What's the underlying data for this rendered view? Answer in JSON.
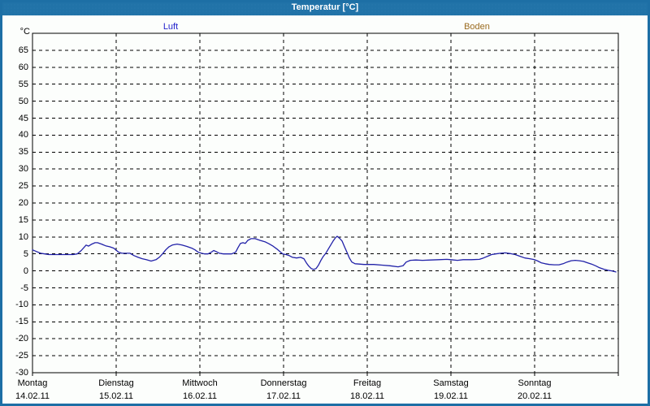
{
  "window": {
    "title": "Temperatur [°C]"
  },
  "legend": {
    "series": [
      {
        "label": "Luft",
        "color": "#2222cc"
      },
      {
        "label": "Boden",
        "color": "#9a6a1e"
      }
    ]
  },
  "axes": {
    "y_unit_label": "°C"
  },
  "colors": {
    "titlebar": "#2173a8",
    "window_border": "#1d6fa5",
    "plot_border": "#000000",
    "gridline": "#000000",
    "background": "#fcfefc"
  },
  "chart_data": {
    "type": "line",
    "title": "Temperatur [°C]",
    "ylabel": "°C",
    "ylim": [
      -30,
      70
    ],
    "yticks_labeled": [
      65,
      60,
      55,
      50,
      45,
      40,
      35,
      30,
      25,
      20,
      15,
      10,
      5,
      0,
      -5,
      -10,
      -15,
      -20,
      -25,
      -30
    ],
    "grid": "dashed",
    "legend_position": "top",
    "xlim_days": [
      0,
      7
    ],
    "x_days": [
      {
        "name": "Montag",
        "date": "14.02.11"
      },
      {
        "name": "Dienstag",
        "date": "15.02.11"
      },
      {
        "name": "Mittwoch",
        "date": "16.02.11"
      },
      {
        "name": "Donnerstag",
        "date": "17.02.11"
      },
      {
        "name": "Freitag",
        "date": "18.02.11"
      },
      {
        "name": "Samstag",
        "date": "19.02.11"
      },
      {
        "name": "Sonntag",
        "date": "20.02.11"
      }
    ],
    "series": [
      {
        "name": "Luft",
        "color": "#2121a8",
        "points": [
          [
            0.0,
            6.2
          ],
          [
            0.049,
            5.7
          ],
          [
            0.097,
            5.2
          ],
          [
            0.146,
            5.0
          ],
          [
            0.194,
            4.8
          ],
          [
            0.291,
            4.8
          ],
          [
            0.388,
            4.8
          ],
          [
            0.485,
            4.8
          ],
          [
            0.534,
            5.0
          ],
          [
            0.583,
            6.0
          ],
          [
            0.641,
            7.6
          ],
          [
            0.67,
            7.3
          ],
          [
            0.709,
            7.9
          ],
          [
            0.748,
            8.3
          ],
          [
            0.777,
            8.3
          ],
          [
            0.825,
            7.9
          ],
          [
            0.874,
            7.4
          ],
          [
            0.922,
            7.1
          ],
          [
            0.971,
            6.7
          ],
          [
            1.029,
            5.5
          ],
          [
            1.068,
            5.2
          ],
          [
            1.165,
            5.2
          ],
          [
            1.214,
            4.5
          ],
          [
            1.262,
            4.0
          ],
          [
            1.311,
            3.6
          ],
          [
            1.359,
            3.3
          ],
          [
            1.417,
            2.9
          ],
          [
            1.476,
            3.3
          ],
          [
            1.515,
            4.0
          ],
          [
            1.553,
            5.0
          ],
          [
            1.592,
            6.2
          ],
          [
            1.631,
            7.1
          ],
          [
            1.67,
            7.6
          ],
          [
            1.728,
            7.9
          ],
          [
            1.786,
            7.6
          ],
          [
            1.845,
            7.2
          ],
          [
            1.903,
            6.7
          ],
          [
            1.942,
            6.2
          ],
          [
            1.981,
            5.5
          ],
          [
            2.019,
            5.2
          ],
          [
            2.058,
            5.0
          ],
          [
            2.097,
            5.0
          ],
          [
            2.136,
            5.5
          ],
          [
            2.165,
            6.0
          ],
          [
            2.194,
            5.7
          ],
          [
            2.233,
            5.2
          ],
          [
            2.282,
            5.0
          ],
          [
            2.379,
            5.0
          ],
          [
            2.427,
            5.5
          ],
          [
            2.456,
            6.9
          ],
          [
            2.485,
            8.1
          ],
          [
            2.515,
            8.3
          ],
          [
            2.544,
            8.1
          ],
          [
            2.573,
            9.0
          ],
          [
            2.612,
            9.5
          ],
          [
            2.66,
            9.5
          ],
          [
            2.718,
            9.0
          ],
          [
            2.777,
            8.6
          ],
          [
            2.825,
            8.0
          ],
          [
            2.874,
            7.3
          ],
          [
            2.922,
            6.4
          ],
          [
            2.961,
            5.6
          ],
          [
            2.99,
            5.0
          ],
          [
            3.029,
            4.8
          ],
          [
            3.068,
            4.5
          ],
          [
            3.107,
            4.0
          ],
          [
            3.155,
            3.8
          ],
          [
            3.204,
            4.0
          ],
          [
            3.243,
            3.6
          ],
          [
            3.272,
            2.4
          ],
          [
            3.301,
            1.4
          ],
          [
            3.33,
            0.7
          ],
          [
            3.359,
            0.4
          ],
          [
            3.388,
            0.7
          ],
          [
            3.417,
            1.7
          ],
          [
            3.447,
            3.1
          ],
          [
            3.476,
            4.3
          ],
          [
            3.505,
            5.2
          ],
          [
            3.534,
            6.4
          ],
          [
            3.563,
            7.6
          ],
          [
            3.592,
            8.8
          ],
          [
            3.621,
            9.8
          ],
          [
            3.641,
            10.2
          ],
          [
            3.67,
            9.6
          ],
          [
            3.699,
            8.8
          ],
          [
            3.728,
            7.1
          ],
          [
            3.757,
            5.5
          ],
          [
            3.786,
            3.8
          ],
          [
            3.816,
            2.6
          ],
          [
            3.854,
            2.1
          ],
          [
            3.903,
            2.0
          ],
          [
            3.961,
            1.9
          ],
          [
            4.0,
            1.9
          ],
          [
            4.078,
            1.9
          ],
          [
            4.175,
            1.7
          ],
          [
            4.272,
            1.5
          ],
          [
            4.369,
            1.2
          ],
          [
            4.427,
            1.5
          ],
          [
            4.466,
            2.6
          ],
          [
            4.515,
            3.1
          ],
          [
            4.583,
            3.2
          ],
          [
            4.66,
            3.1
          ],
          [
            4.757,
            3.2
          ],
          [
            4.854,
            3.3
          ],
          [
            4.951,
            3.4
          ],
          [
            5.0,
            3.3
          ],
          [
            5.078,
            3.1
          ],
          [
            5.146,
            3.3
          ],
          [
            5.243,
            3.3
          ],
          [
            5.34,
            3.4
          ],
          [
            5.388,
            3.8
          ],
          [
            5.437,
            4.3
          ],
          [
            5.485,
            4.8
          ],
          [
            5.534,
            5.0
          ],
          [
            5.592,
            5.2
          ],
          [
            5.65,
            5.3
          ],
          [
            5.709,
            5.1
          ],
          [
            5.767,
            4.8
          ],
          [
            5.825,
            4.3
          ],
          [
            5.883,
            3.8
          ],
          [
            5.942,
            3.6
          ],
          [
            6.0,
            3.3
          ],
          [
            6.039,
            2.9
          ],
          [
            6.078,
            2.4
          ],
          [
            6.126,
            2.1
          ],
          [
            6.175,
            1.9
          ],
          [
            6.233,
            1.8
          ],
          [
            6.291,
            1.8
          ],
          [
            6.34,
            2.1
          ],
          [
            6.388,
            2.6
          ],
          [
            6.437,
            3.0
          ],
          [
            6.485,
            3.1
          ],
          [
            6.534,
            3.0
          ],
          [
            6.583,
            2.8
          ],
          [
            6.631,
            2.4
          ],
          [
            6.68,
            2.0
          ],
          [
            6.728,
            1.5
          ],
          [
            6.777,
            0.9
          ],
          [
            6.825,
            0.5
          ],
          [
            6.874,
            0.2
          ],
          [
            6.922,
            0.0
          ],
          [
            6.971,
            -0.3
          ]
        ]
      },
      {
        "name": "Boden",
        "color": "#9a6a1e",
        "points": []
      }
    ]
  }
}
